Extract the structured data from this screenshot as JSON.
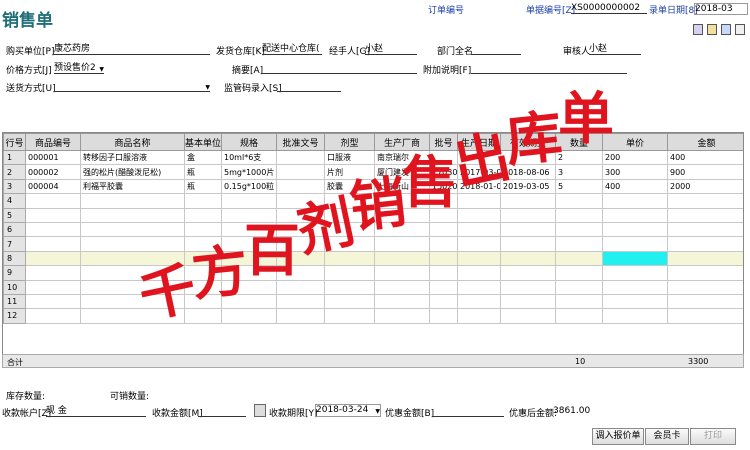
{
  "header": {
    "title": "销售单",
    "order_no_label": "订单编号",
    "doc_no_label": "单据编号[Z]",
    "doc_no_value": "XS0000000002",
    "entry_date_label": "录单日期[8]",
    "entry_date_value": "2018-03"
  },
  "form": {
    "buyer_label": "购买单位[P]",
    "buyer_value": "康芯药房",
    "warehouse_label": "发货仓库[K]",
    "warehouse_value": "配送中心仓库(",
    "handler_label": "经手人[G]",
    "handler_value": "小赵",
    "dept_label": "部门全名",
    "dept_value": "",
    "auditor_label": "审核人",
    "auditor_value": "小赵",
    "price_mode_label": "价格方式[J]",
    "price_mode_value": "预设售价2",
    "summary_label": "摘要[A]",
    "summary_value": "",
    "note_label": "附加说明[F]",
    "note_value": "",
    "ship_mode_label": "送货方式[U]",
    "ship_mode_value": "",
    "supervise_label": "监管码录入[S]",
    "supervise_value": ""
  },
  "grid": {
    "columns": [
      "行号",
      "商品编号",
      "商品名称",
      "基本单位",
      "规格",
      "批准文号",
      "剂型",
      "生产厂商",
      "批号",
      "生产日期",
      "有效期至",
      "数量",
      "单价",
      "金额"
    ],
    "rows": [
      [
        "1",
        "000001",
        "转移因子口服溶液",
        "盒",
        "10ml*6支",
        "",
        "口服液",
        "南京瑞尔",
        "",
        "",
        "",
        "2",
        "200",
        "400"
      ],
      [
        "2",
        "000002",
        "强的松片(醋酸泼尼松)",
        "瓶",
        "5mg*1000片",
        "",
        "片剂",
        "厦门建发",
        "170305",
        "2017-03-05",
        "2018-08-06",
        "3",
        "300",
        "900"
      ],
      [
        "3",
        "000004",
        "利福平胶囊",
        "瓶",
        "0.15g*100粒",
        "",
        "胶囊",
        "上海衡山",
        "150205",
        "2018-01-02",
        "2019-03-05",
        "5",
        "400",
        "2000"
      ],
      [
        "4",
        "",
        "",
        "",
        "",
        "",
        "",
        "",
        "",
        "",
        "",
        "",
        "",
        ""
      ],
      [
        "5",
        "",
        "",
        "",
        "",
        "",
        "",
        "",
        "",
        "",
        "",
        "",
        "",
        ""
      ],
      [
        "6",
        "",
        "",
        "",
        "",
        "",
        "",
        "",
        "",
        "",
        "",
        "",
        "",
        ""
      ],
      [
        "7",
        "",
        "",
        "",
        "",
        "",
        "",
        "",
        "",
        "",
        "",
        "",
        "",
        ""
      ],
      [
        "8",
        "",
        "",
        "",
        "",
        "",
        "",
        "",
        "",
        "",
        "",
        "",
        "",
        ""
      ],
      [
        "9",
        "",
        "",
        "",
        "",
        "",
        "",
        "",
        "",
        "",
        "",
        "",
        "",
        ""
      ],
      [
        "10",
        "",
        "",
        "",
        "",
        "",
        "",
        "",
        "",
        "",
        "",
        "",
        "",
        ""
      ],
      [
        "11",
        "",
        "",
        "",
        "",
        "",
        "",
        "",
        "",
        "",
        "",
        "",
        "",
        ""
      ],
      [
        "12",
        "",
        "",
        "",
        "",
        "",
        "",
        "",
        "",
        "",
        "",
        "",
        "",
        ""
      ]
    ],
    "selected_row": 8,
    "total_label": "合计",
    "total_qty": "10",
    "total_amount": "3300"
  },
  "bottom": {
    "stock_qty_label": "库存数量:",
    "sellable_qty_label": "可销数量:",
    "account_label": "收款帐户[Z]",
    "account_value": "现    金",
    "amount_label": "收款金额[M]",
    "amount_value": "",
    "due_label": "收款期限[Y]",
    "due_value": "2018-03-24",
    "discount_label": "优惠金额[B]",
    "discount_value": "",
    "after_discount_label": "优惠后金额:",
    "after_discount_value": "3861.00"
  },
  "buttons": {
    "import_quote": "调入报价单",
    "member_card": "会员卡",
    "print": "打印"
  },
  "watermark": "千方百剂销售出库单",
  "colors": {
    "watermark": "#e0141e",
    "title": "#1e6e78",
    "selected_cell": "#20f0f0"
  }
}
